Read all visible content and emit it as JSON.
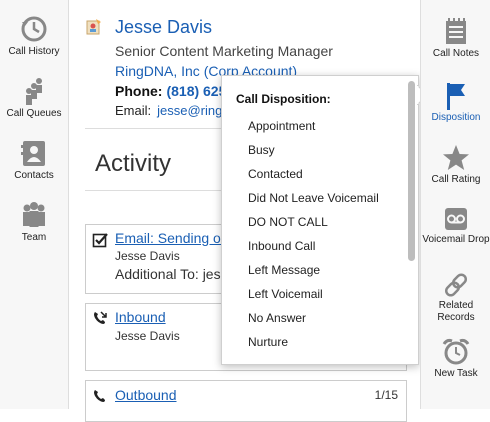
{
  "left_nav": [
    {
      "label": "Call History",
      "icon": "call-history-icon"
    },
    {
      "label": "Call Queues",
      "icon": "call-queues-icon"
    },
    {
      "label": "Contacts",
      "icon": "contacts-icon"
    },
    {
      "label": "Team",
      "icon": "team-icon"
    }
  ],
  "contact": {
    "name": "Jesse Davis",
    "title": "Senior Content Marketing Manager",
    "company": "RingDNA, Inc (Corp Account)",
    "phone_label": "Phone:",
    "phone_value": "(818) 625",
    "email_label": "Email:",
    "email_value": "jesse@ring"
  },
  "activity": {
    "heading": "Activity",
    "items": [
      {
        "title": "Email: Sending ov",
        "person": "Jesse Davis",
        "extra": "Additional To: jes",
        "icon": "checkbox-checked-icon"
      },
      {
        "title": "Inbound",
        "person": "Jesse Davis",
        "icon": "inbound-call-icon"
      },
      {
        "title": "Outbound",
        "count": "1/15",
        "icon": "outbound-call-icon"
      }
    ]
  },
  "right_nav": [
    {
      "label": "Call Notes",
      "icon": "notepad-icon"
    },
    {
      "label": "Disposition",
      "icon": "flag-icon"
    },
    {
      "label": "Call Rating",
      "icon": "star-icon"
    },
    {
      "label": "Voicemail Drop",
      "icon": "voicemail-icon"
    },
    {
      "label": "Related Records",
      "icon": "link-icon"
    },
    {
      "label": "New Task",
      "icon": "alarm-clock-icon"
    }
  ],
  "disposition_popup": {
    "title": "Call Disposition:",
    "options": [
      "Appointment",
      "Busy",
      "Contacted",
      "Did Not Leave Voicemail",
      "DO NOT CALL",
      "Inbound Call",
      "Left Message",
      "Left Voicemail",
      "No Answer",
      "Nurture"
    ]
  },
  "colors": {
    "accent": "#1a5fb4",
    "nav_bg": "#f7f7f7",
    "icon_gray": "#8a8a8a"
  }
}
